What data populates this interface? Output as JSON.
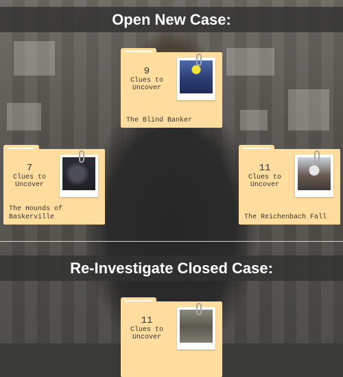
{
  "sections": {
    "open": {
      "title": "Open New Case:"
    },
    "closed": {
      "title": "Re-Investigate Closed Case:"
    }
  },
  "cases_open": [
    {
      "clue_count": "9",
      "clue_label": "Clues to Uncover",
      "title": "The Blind Banker",
      "photo": "blind-banker-photo"
    },
    {
      "clue_count": "7",
      "clue_label": "Clues to Uncover",
      "title": "The Hounds of Baskerville",
      "photo": "hounds-photo"
    },
    {
      "clue_count": "11",
      "clue_label": "Clues to Uncover",
      "title": "The Reichenbach Fall",
      "photo": "reichenbach-photo"
    }
  ],
  "cases_closed": [
    {
      "clue_count": "11",
      "clue_label": "Clues to Uncover",
      "photo": "closed-case-photo"
    }
  ],
  "colors": {
    "folder": "#fedd9e",
    "banner": "#323232",
    "text": "#333333"
  }
}
